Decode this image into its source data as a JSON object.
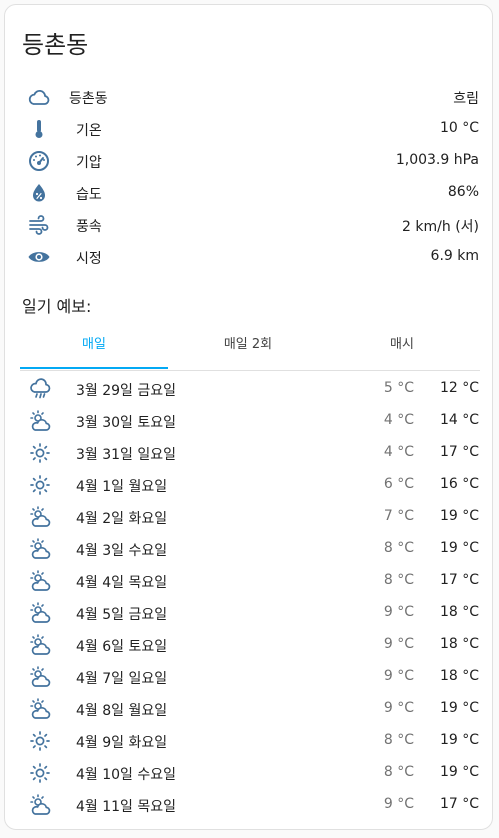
{
  "title": "등촌동",
  "colors": {
    "icon": "#44739e",
    "accent": "#03a9f4"
  },
  "current": {
    "location": "등촌동",
    "condition": "흐림",
    "attributes": [
      {
        "label": "기온",
        "value": "10 °C",
        "icon": "thermometer-icon"
      },
      {
        "label": "기압",
        "value": "1,003.9 hPa",
        "icon": "gauge-icon"
      },
      {
        "label": "습도",
        "value": "86%",
        "icon": "water-percent-icon"
      },
      {
        "label": "풍속",
        "value": "2 km/h (서)",
        "icon": "weather-windy-icon"
      },
      {
        "label": "시정",
        "value": "6.9 km",
        "icon": "eye-icon"
      }
    ]
  },
  "forecast_title": "일기 예보:",
  "tabs": [
    {
      "label": "매일",
      "active": true
    },
    {
      "label": "매일 2회",
      "active": false
    },
    {
      "label": "매시",
      "active": false
    }
  ],
  "forecast": [
    {
      "day": "3월 29일 금요일",
      "low": "5 °C",
      "high": "12 °C",
      "icon": "rainy"
    },
    {
      "day": "3월 30일 토요일",
      "low": "4 °C",
      "high": "14 °C",
      "icon": "partly-cloudy"
    },
    {
      "day": "3월 31일 일요일",
      "low": "4 °C",
      "high": "17 °C",
      "icon": "sunny"
    },
    {
      "day": "4월 1일 월요일",
      "low": "6 °C",
      "high": "16 °C",
      "icon": "sunny"
    },
    {
      "day": "4월 2일 화요일",
      "low": "7 °C",
      "high": "19 °C",
      "icon": "partly-cloudy"
    },
    {
      "day": "4월 3일 수요일",
      "low": "8 °C",
      "high": "19 °C",
      "icon": "partly-cloudy"
    },
    {
      "day": "4월 4일 목요일",
      "low": "8 °C",
      "high": "17 °C",
      "icon": "partly-cloudy"
    },
    {
      "day": "4월 5일 금요일",
      "low": "9 °C",
      "high": "18 °C",
      "icon": "partly-cloudy"
    },
    {
      "day": "4월 6일 토요일",
      "low": "9 °C",
      "high": "18 °C",
      "icon": "partly-cloudy"
    },
    {
      "day": "4월 7일 일요일",
      "low": "9 °C",
      "high": "18 °C",
      "icon": "partly-cloudy"
    },
    {
      "day": "4월 8일 월요일",
      "low": "9 °C",
      "high": "19 °C",
      "icon": "partly-cloudy"
    },
    {
      "day": "4월 9일 화요일",
      "low": "8 °C",
      "high": "19 °C",
      "icon": "sunny"
    },
    {
      "day": "4월 10일 수요일",
      "low": "8 °C",
      "high": "19 °C",
      "icon": "sunny"
    },
    {
      "day": "4월 11일 목요일",
      "low": "9 °C",
      "high": "17 °C",
      "icon": "partly-cloudy"
    }
  ]
}
